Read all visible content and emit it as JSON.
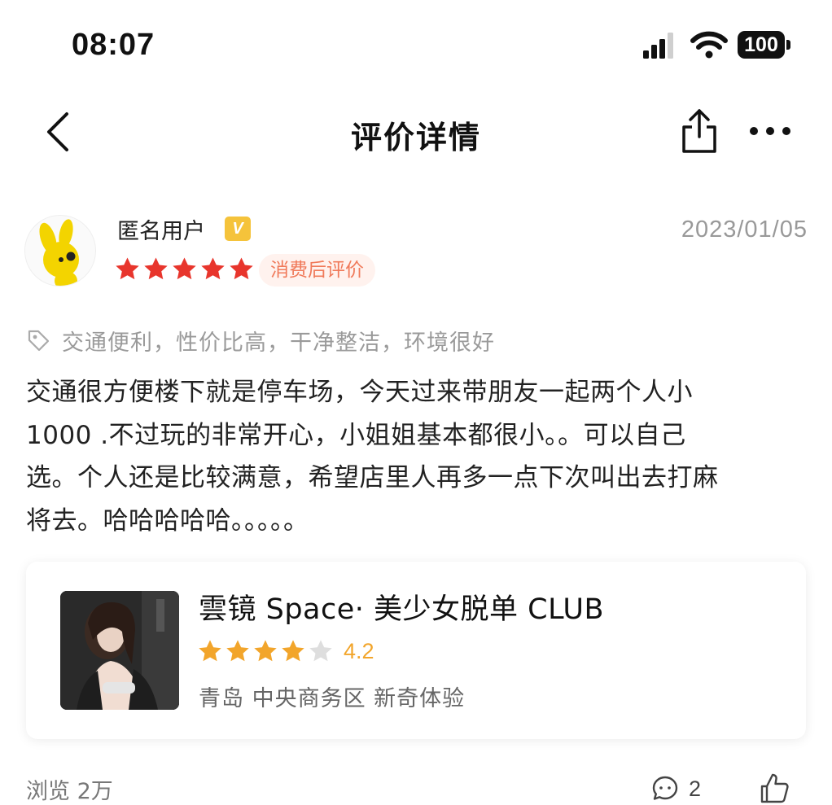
{
  "status_bar": {
    "time": "08:07",
    "battery": "100",
    "icons": [
      "signal-icon",
      "wifi-icon",
      "battery-icon"
    ]
  },
  "nav": {
    "title": "评价详情",
    "icons": [
      "back-arrow-icon",
      "share-icon",
      "more-icon"
    ]
  },
  "review": {
    "username": "匿名用户",
    "badge": "V",
    "date": "2023/01/05",
    "rating": 5,
    "rating_max": 5,
    "consume_tag": "消费后评价",
    "tags": "交通便利，性价比高，干净整洁，环境很好",
    "body_lines": [
      "交通很方便楼下就是停车场，今天过来带朋友一起两个人小",
      "1000 .不过玩的非常开心，小姐姐基本都很小。。可以自己",
      "选。个人还是比较满意，希望店里人再多一点下次叫出去打麻",
      "将去。哈哈哈哈哈。。。。。"
    ]
  },
  "shop": {
    "name": "雲镜 Space· 美少女脱单 CLUB",
    "rating": "4.2",
    "rating_value": 4.2,
    "meta": "青岛 中央商务区 新奇体验"
  },
  "footer": {
    "views": "浏览 2万",
    "comment_count": "2"
  },
  "colors": {
    "star_red": "#e8352c",
    "star_orange": "#f2a52b",
    "star_gray": "#dedede",
    "consume_tag_bg": "#fff2ee",
    "consume_tag_text": "#f07a5a",
    "vip_badge": "#f5c33b"
  }
}
